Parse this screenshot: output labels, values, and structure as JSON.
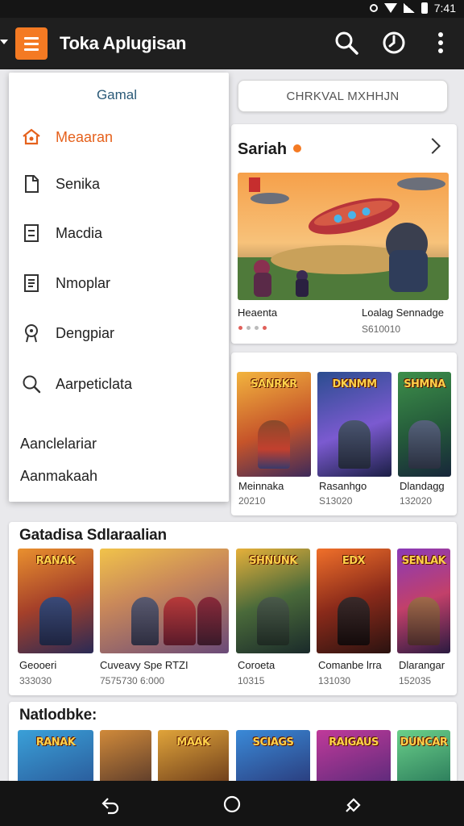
{
  "status_bar": {
    "time": "7:41"
  },
  "app_bar": {
    "title": "Toka Aplugisan",
    "menu_icon": "hamburger-icon",
    "actions": [
      "search-icon",
      "clock-icon",
      "more-vert-icon"
    ]
  },
  "colors": {
    "accent": "#f47a23",
    "drawer_head": "#2b5a78",
    "active_item": "#e5611c",
    "bar": "#1f1f1f"
  },
  "chip": {
    "label": "CHRKVAL MXHHJN"
  },
  "drawer": {
    "header": "Gamal",
    "items": [
      {
        "label": "Meaaran",
        "icon": "home-icon",
        "active": true
      },
      {
        "label": "Senika",
        "icon": "document-icon",
        "active": false
      },
      {
        "label": "Macdia",
        "icon": "document-lines-icon",
        "active": false
      },
      {
        "label": "Nmoplar",
        "icon": "list-document-icon",
        "active": false
      },
      {
        "label": "Dengpiar",
        "icon": "badge-icon",
        "active": false
      },
      {
        "label": "Aarpeticlata",
        "icon": "search-icon",
        "active": false
      }
    ],
    "footer": [
      "Aanclelariar",
      "Aanmakaah"
    ]
  },
  "featured": {
    "title": "Sariah",
    "caption_left": "Heaenta",
    "caption_right": "Loalag Sennadge",
    "sub_right": "S610010",
    "page_dots": 4,
    "active_dots": [
      0,
      3
    ]
  },
  "games_card": {
    "items": [
      {
        "name": "Meinnaka",
        "sub": "20210",
        "tile_text": "SANRKR"
      },
      {
        "name": "Rasanhgo",
        "sub": "S13020",
        "tile_text": "DKNMM"
      },
      {
        "name": "Dlandagg",
        "sub": "132020",
        "tile_text": "SHMNA"
      }
    ]
  },
  "section1": {
    "title": "Gatadisa Sdlaraalian",
    "items": [
      {
        "name": "Geooeri",
        "sub": "333030",
        "tile_text": "RANAK"
      },
      {
        "name": "Cuveavy Spe RTZI",
        "sub": "7575730 6:000",
        "tile_text": ""
      },
      {
        "name": "Coroeta",
        "sub": "10315",
        "tile_text": "SHNUNK"
      },
      {
        "name": "Comanbe lrra",
        "sub": "131030",
        "tile_text": "EDX"
      },
      {
        "name": "Dlarangar",
        "sub": "152035",
        "tile_text": "SENLAK"
      }
    ]
  },
  "section2": {
    "title": "Natlodbke:",
    "items": [
      {
        "tile_text": "RANAK"
      },
      {
        "tile_text": ""
      },
      {
        "tile_text": "MAAK"
      },
      {
        "tile_text": "SCIAGS"
      },
      {
        "tile_text": "RAIGAUS"
      },
      {
        "tile_text": "DUNCAR"
      }
    ]
  },
  "nav_bar": {
    "buttons": [
      "back-icon",
      "home-icon",
      "recents-icon"
    ]
  }
}
